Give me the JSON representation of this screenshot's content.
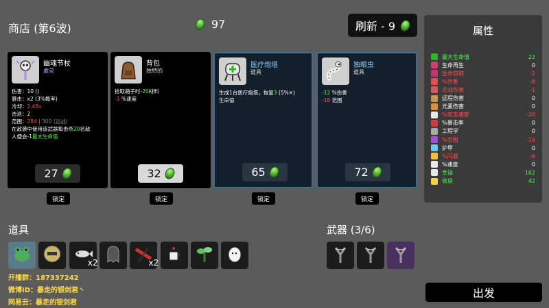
{
  "header": {
    "shop_title": "商店 (第6波)",
    "materials": "97",
    "refresh_label": "刷新 - 9"
  },
  "cards": [
    {
      "name": "幽魂节杖",
      "type": "虚灵",
      "price": "27",
      "lock": "锁定",
      "lines": [
        [
          {
            "t": "伤害：10 (",
            "c": ""
          },
          {
            "t": "",
            "c": ""
          },
          {
            "t": ")",
            "c": ""
          }
        ],
        [
          {
            "t": "暴击：x2 (3%概率)",
            "c": ""
          }
        ],
        [
          {
            "t": "冷却：",
            "c": ""
          },
          {
            "t": "1.45s",
            "c": "red"
          }
        ],
        [
          {
            "t": "击退：2",
            "c": ""
          }
        ],
        [
          {
            "t": "范围：",
            "c": ""
          },
          {
            "t": "284",
            "c": "red"
          },
          {
            "t": " | 300 (远战)",
            "c": "grey"
          }
        ],
        [
          {
            "t": "在敌袭中使用该武器每击杀",
            "c": ""
          },
          {
            "t": "20",
            "c": "green"
          },
          {
            "t": "名敌",
            "c": ""
          }
        ],
        [
          {
            "t": "人便会-1",
            "c": ""
          },
          {
            "t": "最大生命值",
            "c": "green"
          }
        ]
      ]
    },
    {
      "name": "背包",
      "type": "独特的",
      "price": "32",
      "lock": "锁定",
      "lines": [
        [
          {
            "t": "拾取箱子时-",
            "c": ""
          },
          {
            "t": "20",
            "c": "green"
          },
          {
            "t": "材料",
            "c": ""
          }
        ],
        [
          {
            "t": "-1",
            "c": "red"
          },
          {
            "t": " %速度",
            "c": ""
          }
        ]
      ]
    },
    {
      "name": "医疗炮塔",
      "type": "道具",
      "price": "65",
      "lock": "锁定",
      "lines": [
        [
          {
            "t": "生成1台医疗炮塔，恢复",
            "c": ""
          },
          {
            "t": "3",
            "c": "green"
          },
          {
            "t": " (5%",
            "c": ""
          },
          {
            "t": "✕",
            "c": ""
          },
          {
            "t": ")",
            "c": ""
          }
        ],
        [
          {
            "t": "生命值",
            "c": ""
          }
        ]
      ]
    },
    {
      "name": "独眼虫",
      "type": "道具",
      "price": "72",
      "lock": "锁定",
      "lines": [
        [
          {
            "t": "-12",
            "c": "green"
          },
          {
            "t": " %伤害",
            "c": ""
          }
        ],
        [
          {
            "t": "-18",
            "c": "red"
          },
          {
            "t": " 范围",
            "c": ""
          }
        ]
      ]
    }
  ],
  "attributes": {
    "title": "属性",
    "rows": [
      {
        "label": "最大生命值",
        "value": "22",
        "color": "#4cff4c",
        "icon_color": "#2db42d"
      },
      {
        "label": "生命再生",
        "value": "0",
        "color": "#ffffff",
        "icon_color": "#d23c6e"
      },
      {
        "label": "生命窃取",
        "value": "-2",
        "color": "#ff4d4d",
        "icon_color": "#c8326e"
      },
      {
        "label": "%伤害",
        "value": "-8",
        "color": "#ff4d4d",
        "icon_color": "#e05050"
      },
      {
        "label": "近战伤害",
        "value": "-1",
        "color": "#ff4d4d",
        "icon_color": "#d25a5a"
      },
      {
        "label": "远程伤害",
        "value": "0",
        "color": "#ffffff",
        "icon_color": "#c89650"
      },
      {
        "label": "元素伤害",
        "value": "0",
        "color": "#ffffff",
        "icon_color": "#e08c3c"
      },
      {
        "label": "%攻击速度",
        "value": "-20",
        "color": "#ff4d4d",
        "icon_color": "#e8e8e8"
      },
      {
        "label": "%暴击率",
        "value": "0",
        "color": "#ffffff",
        "icon_color": "#d23c3c"
      },
      {
        "label": "工程学",
        "value": "0",
        "color": "#ffffff",
        "icon_color": "#aaaaaa"
      },
      {
        "label": "%范围",
        "value": "-16",
        "color": "#ff4d4d",
        "icon_color": "#a050d0"
      },
      {
        "label": "护甲",
        "value": "0",
        "color": "#ffffff",
        "icon_color": "#6ec8ff"
      },
      {
        "label": "%闪避",
        "value": "-6",
        "color": "#ff4d4d",
        "icon_color": "#f0c03c"
      },
      {
        "label": "%速度",
        "value": "0",
        "color": "#ffffff",
        "icon_color": "#e8e8e8"
      },
      {
        "label": "幸运",
        "value": "162",
        "color": "#4cff4c",
        "icon_color": "#e8e8e8"
      },
      {
        "label": "收获",
        "value": "42",
        "color": "#4cff4c",
        "icon_color": "#f0d250"
      }
    ]
  },
  "inventory": {
    "items_title": "道具",
    "items": [
      {
        "icon": "frog-icon",
        "qty": ""
      },
      {
        "icon": "helmet-icon",
        "qty": ""
      },
      {
        "icon": "fish-icon",
        "qty": "x2"
      },
      {
        "icon": "ghost-icon",
        "qty": ""
      },
      {
        "icon": "scarf-icon",
        "qty": "x2"
      },
      {
        "icon": "coffee-cup-icon",
        "qty": ""
      },
      {
        "icon": "plant-icon",
        "qty": ""
      },
      {
        "icon": "egg-icon",
        "qty": ""
      }
    ],
    "weapons_title": "武器 (3/6)",
    "weapons": [
      {
        "icon": "slingshot-icon",
        "tier_color": "#1c1c1c"
      },
      {
        "icon": "slingshot-icon",
        "tier_color": "#1c1c1c"
      },
      {
        "icon": "slingshot-icon",
        "tier_color": "#4a3060"
      }
    ]
  },
  "start_label": "出发",
  "promo": [
    "开播群：187337242",
    "微博ID：暴走的银剑君丶",
    "网易云：暴走的银剑君"
  ]
}
